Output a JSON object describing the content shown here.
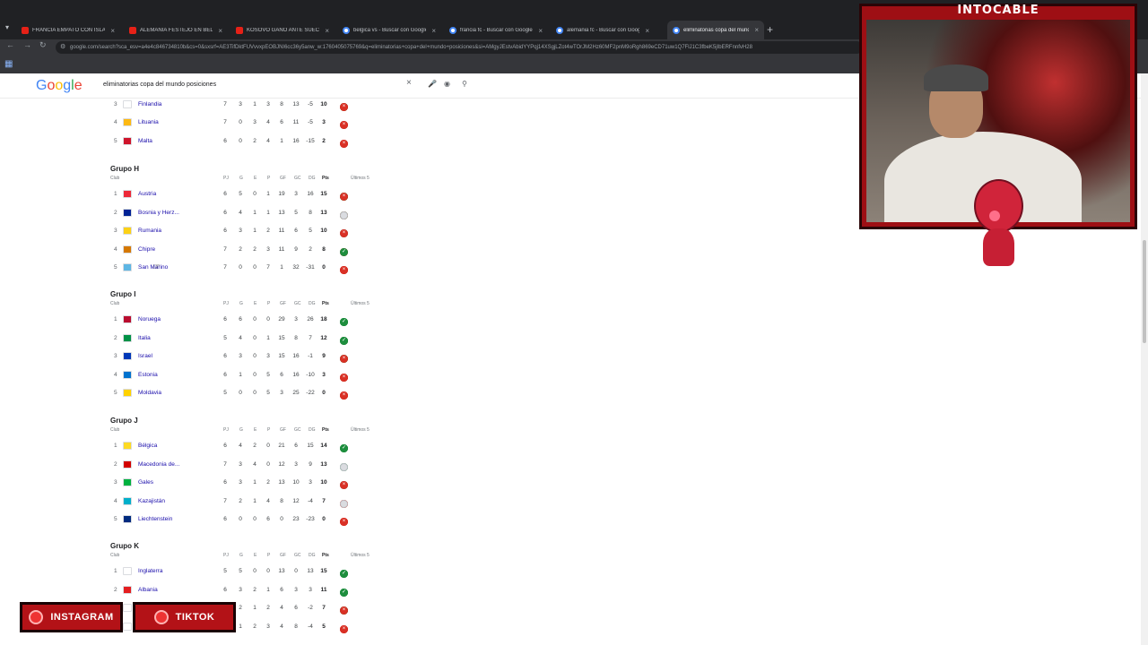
{
  "browser": {
    "tabs": [
      {
        "label": "FRANCIA EMPATÓ CON ISLAND",
        "kind": "yt"
      },
      {
        "label": "ALEMANIA FESTEJO EN BELFA",
        "kind": "yt"
      },
      {
        "label": "KOSOVO GANÓ ANTE SUECIA",
        "kind": "yt"
      },
      {
        "label": "belgica vs - Buscar con Google",
        "kind": "g"
      },
      {
        "label": "francia fc - Buscar con Google",
        "kind": "g"
      },
      {
        "label": "alemania fc - Buscar con Googl",
        "kind": "g"
      },
      {
        "label": "eliminatorias copa del mundo",
        "kind": "g"
      }
    ],
    "url": "google.com/search?sca_esv=a4e4c846734810b&cs=0&sxsrf=AE3TifDktFUVvvxpEOBJNI6cc36y5anw_w:1760405075769&q=eliminatorias+copa+del+mundo+posiciones&si=AMgyJEstvAbidYYPqj14XSgjLZot4wTOrJM2Hz60MF2pnM9oRgh869eCD71uw1Q7FlJ1C3fbeK5jIbERFnnfvH28"
  },
  "google": {
    "logo": "Google",
    "query": "eliminatorias copa del mundo posiciones"
  },
  "standings": {
    "columns": {
      "club": "Club",
      "pj": "PJ",
      "g": "G",
      "e": "E",
      "p": "P",
      "gf": "GF",
      "gc": "GC",
      "dg": "DG",
      "pts": "Pts",
      "last5": "Últimos 5"
    },
    "partial_group": {
      "rows": [
        {
          "pos": "3",
          "team": "Finlandia",
          "pj": "7",
          "g": "3",
          "e": "1",
          "p": "3",
          "gf": "8",
          "gc": "13",
          "dg": "-5",
          "pts": "10",
          "last5": [
            "W",
            "W",
            "W",
            "L",
            "L"
          ],
          "flag": "#ffffff"
        },
        {
          "pos": "4",
          "team": "Lituania",
          "pj": "7",
          "g": "0",
          "e": "3",
          "p": "4",
          "gf": "6",
          "gc": "11",
          "dg": "-5",
          "pts": "3",
          "last5": [
            "W",
            "D",
            "D",
            "L",
            "L"
          ],
          "flag": "#fdb913"
        },
        {
          "pos": "5",
          "team": "Malta",
          "pj": "6",
          "g": "0",
          "e": "2",
          "p": "4",
          "gf": "1",
          "gc": "16",
          "dg": "-15",
          "pts": "2",
          "last5": [
            "L",
            "D",
            "D",
            "L",
            "L"
          ],
          "flag": "#cf142b"
        }
      ]
    },
    "groups": [
      {
        "title": "Grupo H",
        "rows": [
          {
            "pos": "1",
            "team": "Austria",
            "pj": "6",
            "g": "5",
            "e": "0",
            "p": "1",
            "gf": "19",
            "gc": "3",
            "dg": "16",
            "pts": "15",
            "last5": [
              "W",
              "W",
              "W",
              "W",
              "L"
            ],
            "flag": "#ed2939"
          },
          {
            "pos": "2",
            "team": "Bosnia y Herz...",
            "pj": "6",
            "g": "4",
            "e": "1",
            "p": "1",
            "gf": "13",
            "gc": "5",
            "dg": "8",
            "pts": "13",
            "last5": [
              "W",
              "W",
              "W",
              "L",
              "N"
            ],
            "flag": "#002395"
          },
          {
            "pos": "3",
            "team": "Rumania",
            "pj": "6",
            "g": "3",
            "e": "1",
            "p": "2",
            "gf": "11",
            "gc": "6",
            "dg": "5",
            "pts": "10",
            "last5": [
              "W",
              "L",
              "W",
              "D",
              "L"
            ],
            "flag": "#fcd116"
          },
          {
            "pos": "4",
            "team": "Chipre",
            "pj": "7",
            "g": "2",
            "e": "2",
            "p": "3",
            "gf": "11",
            "gc": "9",
            "dg": "2",
            "pts": "8",
            "last5": [
              "L",
              "L",
              "D",
              "L",
              "W"
            ],
            "flag": "#d57800"
          },
          {
            "pos": "5",
            "team": "San Marino",
            "pj": "7",
            "g": "0",
            "e": "0",
            "p": "7",
            "gf": "1",
            "gc": "32",
            "dg": "-31",
            "pts": "0",
            "last5": [
              "L",
              "L",
              "L",
              "L",
              "L"
            ],
            "flag": "#5eb6e4"
          }
        ]
      },
      {
        "title": "Grupo I",
        "rows": [
          {
            "pos": "1",
            "team": "Noruega",
            "pj": "6",
            "g": "6",
            "e": "0",
            "p": "0",
            "gf": "29",
            "gc": "3",
            "dg": "26",
            "pts": "18",
            "last5": [
              "W",
              "W",
              "W",
              "W",
              "W"
            ],
            "flag": "#ba0c2f"
          },
          {
            "pos": "2",
            "team": "Italia",
            "pj": "5",
            "g": "4",
            "e": "0",
            "p": "1",
            "gf": "15",
            "gc": "8",
            "dg": "7",
            "pts": "12",
            "last5": [
              "L",
              "W",
              "W",
              "W",
              "W"
            ],
            "flag": "#009246"
          },
          {
            "pos": "3",
            "team": "Israel",
            "pj": "6",
            "g": "3",
            "e": "0",
            "p": "3",
            "gf": "15",
            "gc": "16",
            "dg": "-1",
            "pts": "9",
            "last5": [
              "W",
              "W",
              "L",
              "W",
              "L"
            ],
            "flag": "#0038b8"
          },
          {
            "pos": "4",
            "team": "Estonia",
            "pj": "6",
            "g": "1",
            "e": "0",
            "p": "5",
            "gf": "6",
            "gc": "16",
            "dg": "-10",
            "pts": "3",
            "last5": [
              "L",
              "W",
              "L",
              "L",
              "L"
            ],
            "flag": "#0072ce"
          },
          {
            "pos": "5",
            "team": "Moldavia",
            "pj": "5",
            "g": "0",
            "e": "0",
            "p": "5",
            "gf": "3",
            "gc": "25",
            "dg": "-22",
            "pts": "0",
            "last5": [
              "L",
              "L",
              "L",
              "L",
              "L"
            ],
            "flag": "#ffd200"
          }
        ]
      },
      {
        "title": "Grupo J",
        "rows": [
          {
            "pos": "1",
            "team": "Bélgica",
            "pj": "6",
            "g": "4",
            "e": "2",
            "p": "0",
            "gf": "21",
            "gc": "6",
            "dg": "15",
            "pts": "14",
            "last5": [
              "W",
              "W",
              "W",
              "W",
              "W"
            ],
            "flag": "#fdda24"
          },
          {
            "pos": "2",
            "team": "Macedonia de...",
            "pj": "7",
            "g": "3",
            "e": "4",
            "p": "0",
            "gf": "12",
            "gc": "3",
            "dg": "9",
            "pts": "13",
            "last5": [
              "W",
              "W",
              "W",
              "D",
              "N"
            ],
            "flag": "#d20000"
          },
          {
            "pos": "3",
            "team": "Gales",
            "pj": "6",
            "g": "3",
            "e": "1",
            "p": "2",
            "gf": "13",
            "gc": "10",
            "dg": "3",
            "pts": "10",
            "last5": [
              "W",
              "W",
              "L",
              "D",
              "L"
            ],
            "flag": "#00b140"
          },
          {
            "pos": "4",
            "team": "Kazajistán",
            "pj": "7",
            "g": "2",
            "e": "1",
            "p": "4",
            "gf": "8",
            "gc": "12",
            "dg": "-4",
            "pts": "7",
            "last5": [
              "L",
              "L",
              "L",
              "L",
              "N"
            ],
            "flag": "#00afca"
          },
          {
            "pos": "5",
            "team": "Liechtenstein",
            "pj": "6",
            "g": "0",
            "e": "0",
            "p": "6",
            "gf": "0",
            "gc": "23",
            "dg": "-23",
            "pts": "0",
            "last5": [
              "L",
              "L",
              "L",
              "L",
              "L"
            ],
            "flag": "#002b7f"
          }
        ]
      },
      {
        "title": "Grupo K",
        "rows": [
          {
            "pos": "1",
            "team": "Inglaterra",
            "pj": "5",
            "g": "5",
            "e": "0",
            "p": "0",
            "gf": "13",
            "gc": "0",
            "dg": "13",
            "pts": "15",
            "last5": [
              "W",
              "W",
              "W",
              "W",
              "W"
            ],
            "flag": "#ffffff"
          },
          {
            "pos": "2",
            "team": "Albania",
            "pj": "6",
            "g": "3",
            "e": "2",
            "p": "1",
            "gf": "6",
            "gc": "3",
            "dg": "3",
            "pts": "11",
            "last5": [
              "W",
              "D",
              "W",
              "W",
              "W"
            ],
            "flag": "#e41e20"
          },
          {
            "pos": "3",
            "team": "",
            "pj": "",
            "g": "2",
            "e": "1",
            "p": "2",
            "gf": "4",
            "gc": "6",
            "dg": "-2",
            "pts": "7",
            "last5": [
              "W",
              "W",
              "L",
              "W",
              "L"
            ],
            "flag": "#ffffff"
          },
          {
            "pos": "4",
            "team": "",
            "pj": "",
            "g": "1",
            "e": "2",
            "p": "3",
            "gf": "4",
            "gc": "8",
            "dg": "-4",
            "pts": "5",
            "last5": [
              "L",
              "L",
              "L",
              "L",
              "L"
            ],
            "flag": "#ffffff"
          }
        ]
      }
    ]
  },
  "overlay": {
    "streamer_name": "INTOCABLE",
    "socials": [
      {
        "label": "INSTAGRAM"
      },
      {
        "label": "TIKTOK"
      }
    ]
  }
}
